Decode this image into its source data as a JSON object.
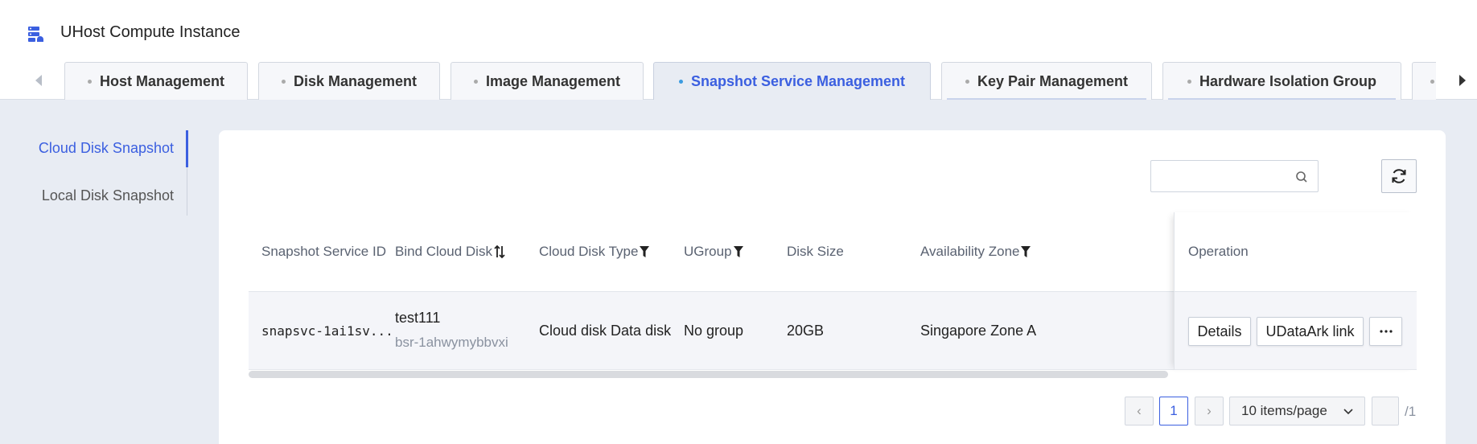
{
  "app": {
    "title": "UHost Compute Instance",
    "icon": "server-stack-icon"
  },
  "tabs": [
    {
      "label": "Host Management",
      "active": false
    },
    {
      "label": "Disk Management",
      "active": false
    },
    {
      "label": "Image Management",
      "active": false
    },
    {
      "label": "Snapshot Service Management",
      "active": true
    },
    {
      "label": "Key Pair Management",
      "active": false
    },
    {
      "label": "Hardware Isolation Group",
      "active": false
    }
  ],
  "sidebar": {
    "items": [
      {
        "label": "Cloud Disk Snapshot",
        "active": true
      },
      {
        "label": "Local Disk Snapshot",
        "active": false
      }
    ]
  },
  "search": {
    "value": "",
    "placeholder": ""
  },
  "table": {
    "columns": [
      "Snapshot Service ID",
      "Bind Cloud Disk",
      "Cloud Disk Type",
      "UGroup",
      "Disk Size",
      "Availability Zone",
      "Operation"
    ],
    "rows": [
      {
        "id": "snapsvc-1ai1sv...",
        "disk_name": "test111",
        "disk_id": "bsr-1ahwymybbvxi",
        "disk_type": "Cloud disk Data disk",
        "ugroup": "No group",
        "size": "20GB",
        "zone": "Singapore Zone A",
        "actions": {
          "details": "Details",
          "link": "UDataArk link",
          "more": "···"
        }
      }
    ]
  },
  "pagination": {
    "current": "1",
    "prev": "‹",
    "next": "›",
    "page_size": "10 items/page",
    "jump_value": "",
    "total": "/1"
  },
  "colors": {
    "accent": "#3b5fe0",
    "page_bg": "#e8ecf3"
  }
}
